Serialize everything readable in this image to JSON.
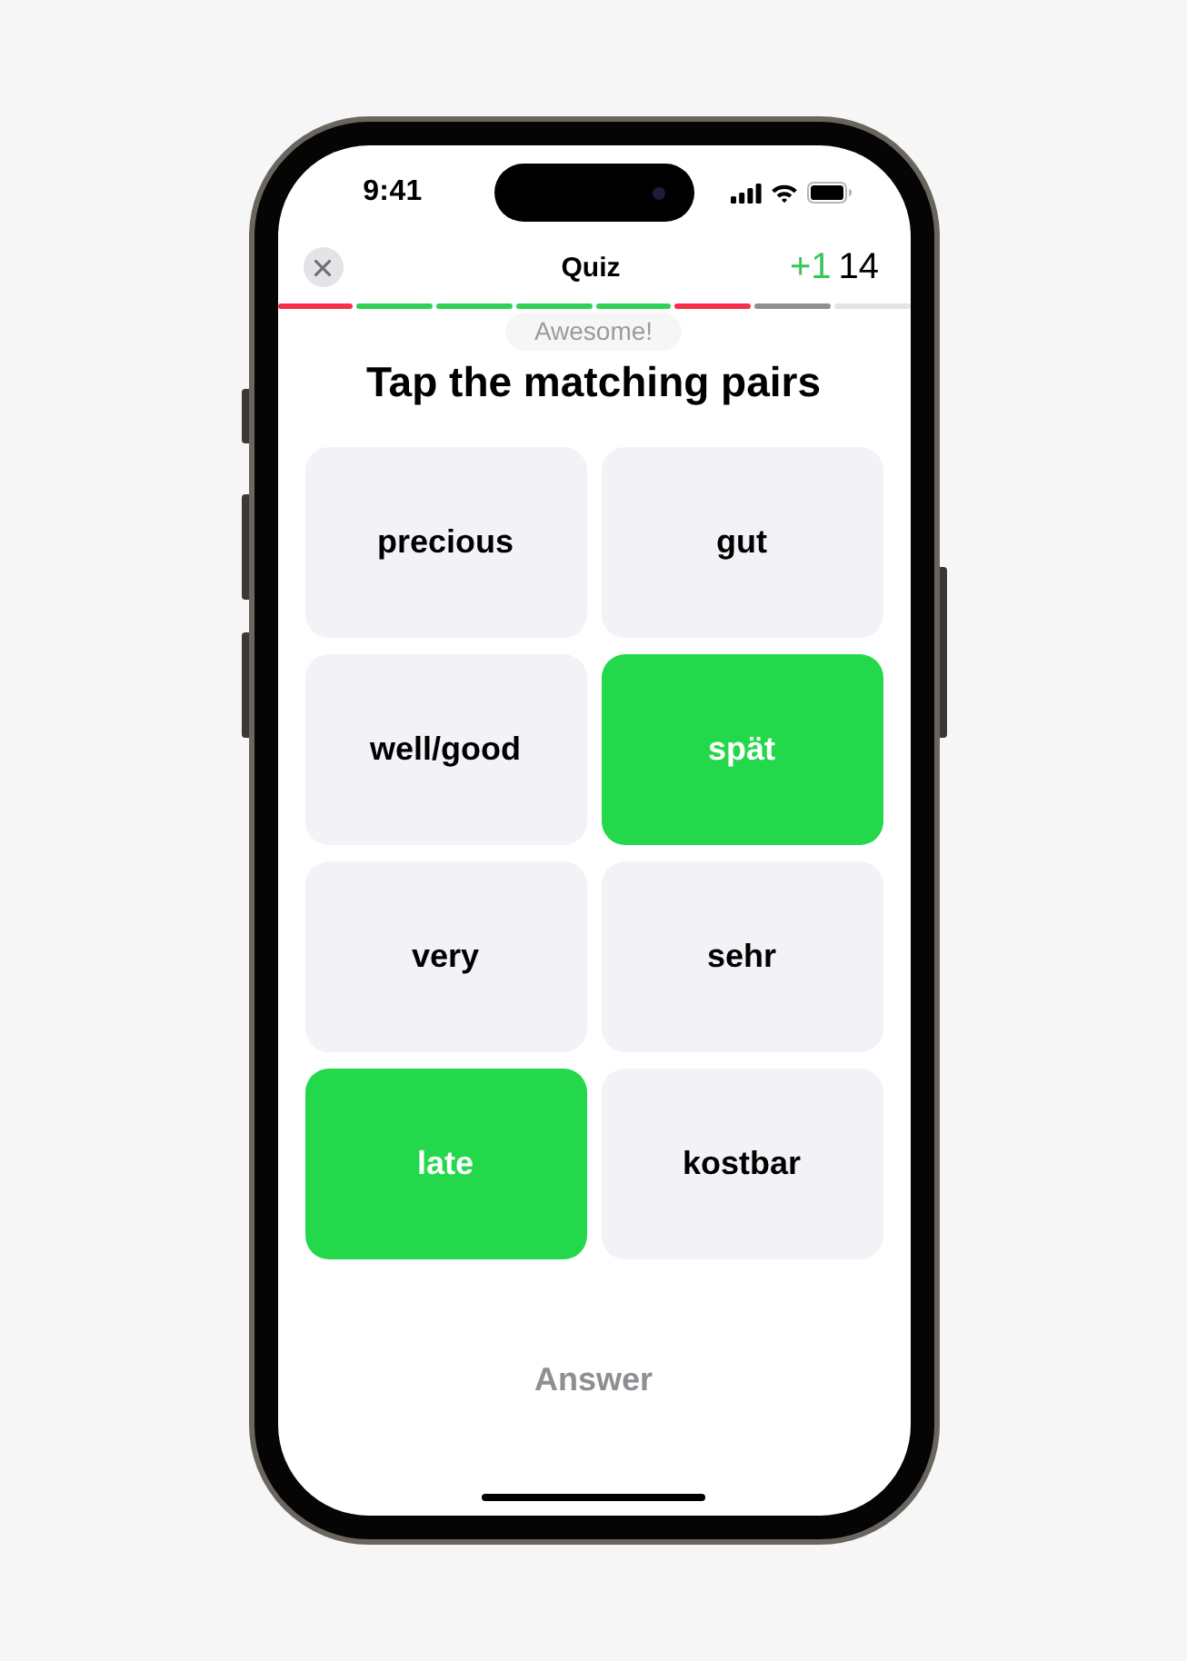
{
  "status_bar": {
    "time": "9:41"
  },
  "header": {
    "title": "Quiz",
    "gain": "+1",
    "score": "14"
  },
  "progress": [
    {
      "color": "#f7304a"
    },
    {
      "color": "#2fd259"
    },
    {
      "color": "#2fd259"
    },
    {
      "color": "#2fd259"
    },
    {
      "color": "#2fd259"
    },
    {
      "color": "#f7304a"
    },
    {
      "color": "#8e8e93"
    },
    {
      "color": "#e3e3e8"
    }
  ],
  "toast": "Awesome!",
  "prompt": "Tap the matching pairs",
  "cards": [
    {
      "label": "precious",
      "matched": false
    },
    {
      "label": "gut",
      "matched": false
    },
    {
      "label": "well/good",
      "matched": false
    },
    {
      "label": "spät",
      "matched": true
    },
    {
      "label": "very",
      "matched": false
    },
    {
      "label": "sehr",
      "matched": false
    },
    {
      "label": "late",
      "matched": true
    },
    {
      "label": "kostbar",
      "matched": false
    }
  ],
  "answer_button": {
    "label": "Answer",
    "disabled": true
  }
}
